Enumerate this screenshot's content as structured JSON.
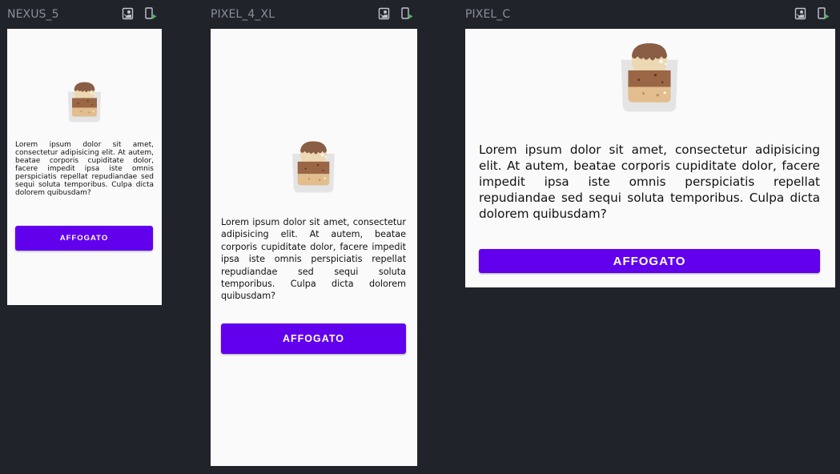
{
  "colors": {
    "canvas_background": "#21232b",
    "screen_background": "#fafafa",
    "button_background": "#6200ee",
    "button_text": "#ffffff",
    "device_label": "#8a8e99"
  },
  "devices": [
    {
      "name": "NEXUS_5",
      "icons": [
        "portrait-orientation-icon",
        "device-run-icon"
      ],
      "content": {
        "image": "affogato-cup",
        "text": "Lorem ipsum dolor sit amet, consectetur adipisicing elit. At autem, beatae corporis cupiditate dolor, facere impedit ipsa iste omnis perspiciatis repellat repudiandae sed sequi soluta temporibus. Culpa dicta dolorem quibusdam?",
        "button_label": "AFFOGATO"
      }
    },
    {
      "name": "PIXEL_4_XL",
      "icons": [
        "portrait-orientation-icon",
        "device-run-icon"
      ],
      "content": {
        "image": "affogato-cup",
        "text": "Lorem ipsum dolor sit amet, consectetur adipisicing elit. At autem, beatae corporis cupiditate dolor, facere impedit ipsa iste omnis perspiciatis repellat repudiandae sed sequi soluta temporibus. Culpa dicta dolorem quibusdam?",
        "button_label": "AFFOGATO"
      }
    },
    {
      "name": "PIXEL_C",
      "icons": [
        "portrait-orientation-icon",
        "device-run-icon"
      ],
      "content": {
        "image": "affogato-cup",
        "text": "Lorem ipsum dolor sit amet, consectetur adipisicing elit. At autem, beatae corporis cupiditate dolor, facere impedit ipsa iste omnis perspiciatis repellat repudiandae sed sequi soluta temporibus. Culpa dicta dolorem quibusdam?",
        "button_label": "AFFOGATO"
      }
    }
  ]
}
